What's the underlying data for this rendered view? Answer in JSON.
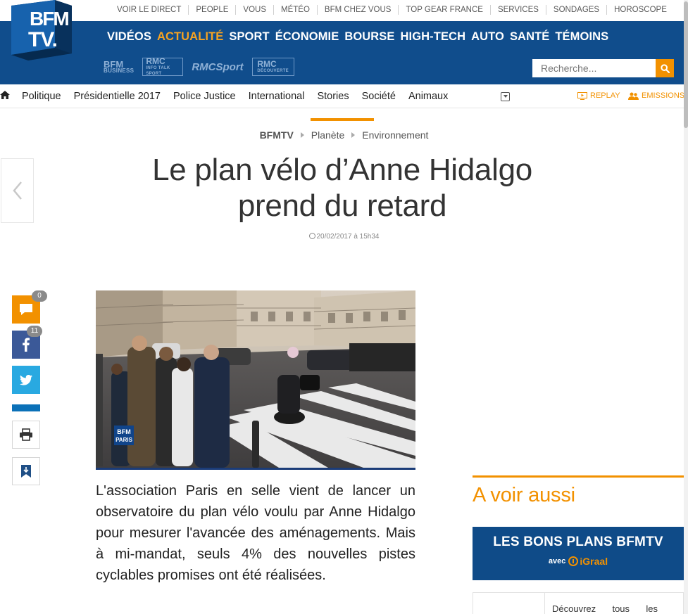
{
  "header": {
    "logo_text_1": "BFM",
    "logo_text_2": "TV.",
    "top_links": [
      "VOIR LE DIRECT",
      "PEOPLE",
      "VOUS",
      "MÉTÉO",
      "BFM CHEZ VOUS",
      "TOP GEAR FRANCE",
      "SERVICES",
      "SONDAGES",
      "HOROSCOPE"
    ],
    "main_nav": [
      {
        "label": "VIDÉOS",
        "active": false
      },
      {
        "label": "ACTUALITÉ",
        "active": true
      },
      {
        "label": "SPORT",
        "active": false
      },
      {
        "label": "ÉCONOMIE",
        "active": false
      },
      {
        "label": "BOURSE",
        "active": false
      },
      {
        "label": "HIGH-TECH",
        "active": false
      },
      {
        "label": "AUTO",
        "active": false
      },
      {
        "label": "SANTÉ",
        "active": false
      },
      {
        "label": "TÉMOINS",
        "active": false
      }
    ],
    "brands": {
      "bfm_business_1": "BFM",
      "bfm_business_2": "BUSINESS",
      "rmc_talk_1": "RMC",
      "rmc_talk_2": "INFO TALK SPORT",
      "rmc_sport_1": "RMC",
      "rmc_sport_2": "Sport",
      "rmc_decouverte_1": "RMC",
      "rmc_decouverte_2": "DÉCOUVERTE"
    },
    "search_placeholder": "Recherche..."
  },
  "subnav": {
    "links": [
      "Politique",
      "Présidentielle 2017",
      "Police Justice",
      "International",
      "Stories",
      "Société",
      "Animaux"
    ],
    "replay": "REPLAY",
    "emissions": "EMISSIONS"
  },
  "article": {
    "breadcrumb": [
      "BFMTV",
      "Planète",
      "Environnement"
    ],
    "title_line_1": "Le plan vélo d’Anne Hidalgo",
    "title_line_2": "prend du retard",
    "date": "20/02/2017 à 15h34",
    "photo_watermark_1": "BFM",
    "photo_watermark_2": "PARIS",
    "lead": "L'association Paris en selle vient de lancer un observatoire du plan vélo voulu par Anne Hidalgo pour mesurer l'avancée des aménagements. Mais à mi-mandat, seuls 4% des nouvelles pistes cyclables promises ont été réalisées."
  },
  "share": {
    "comment_count": "0",
    "facebook_count": "11"
  },
  "sidebar": {
    "a_voir_aussi": "A voir aussi",
    "bons_plans_title": "LES BONS PLANS BFMTV",
    "bons_plans_avec": "avec",
    "bons_plans_partner": "iGraal",
    "promo_words": [
      "Découvrez",
      "tous",
      "les"
    ]
  },
  "colors": {
    "brand_blue": "#104d8c",
    "accent_orange": "#f29100",
    "facebook": "#3b5998",
    "twitter": "#29a9e1"
  }
}
